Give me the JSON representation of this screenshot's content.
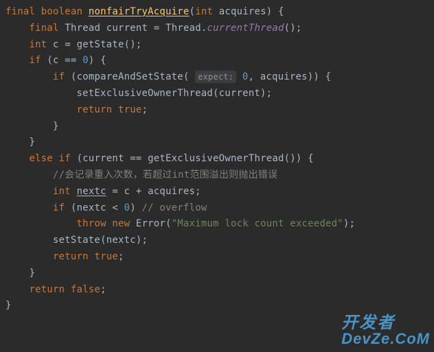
{
  "code": {
    "l1": {
      "kw1": "final",
      "kw2": "boolean",
      "mname": "nonfairTryAcquire",
      "p_kw": "int",
      "p_name": "acquires"
    },
    "l2": {
      "kw1": "final",
      "type": "Thread",
      "var": "current",
      "eq": "=",
      "type2": "Thread",
      "dot": ".",
      "ital": "currentThread",
      "suffix": "();"
    },
    "l3": {
      "kw": "int",
      "var": "c",
      "eq": "=",
      "call": "getState",
      "suffix": "();"
    },
    "l4": {
      "kw": "if",
      "open": "(c ==",
      "num": "0",
      "close": ") {"
    },
    "l5": {
      "kw": "if",
      "open": "(",
      "call": "compareAndSetState",
      "popen": "(",
      "hint": "expect:",
      "num": "0",
      "comma": ",",
      "arg": "acquires",
      "close": ")) {"
    },
    "l6": {
      "call": "setExclusiveOwnerThread",
      "arg": "(current);"
    },
    "l7": {
      "kw": "return",
      "val": "true",
      "semi": ";"
    },
    "l8": {
      "brace": "}"
    },
    "l9": {
      "brace": "}"
    },
    "l10": {
      "kw1": "else",
      "kw2": "if",
      "open": "(current ==",
      "call": "getExclusiveOwnerThread",
      "suffix": "()) {"
    },
    "l11": {
      "cmt": "//会记录重入次数，若超过int范围溢出则抛出错误"
    },
    "l12": {
      "kw": "int",
      "var": "nextc",
      "eq": "=",
      "expr": "c + acquires;"
    },
    "l13": {
      "kw": "if",
      "open": "(nextc <",
      "num": "0",
      "close": ")",
      "cmt": "// overflow"
    },
    "l14": {
      "kw1": "throw",
      "kw2": "new",
      "type": "Error",
      "str": "\"Maximum lock count exceeded\"",
      "close": ");"
    },
    "l15": {
      "call": "setState",
      "arg": "(nextc);"
    },
    "l16": {
      "kw": "return",
      "val": "true",
      "semi": ";"
    },
    "l17": {
      "brace": "}"
    },
    "l18": {
      "kw": "return",
      "val": "false",
      "semi": ";"
    },
    "l19": {
      "brace": "}"
    }
  },
  "watermark": {
    "line1": "开发者",
    "line2": "DevZe.CoM"
  }
}
